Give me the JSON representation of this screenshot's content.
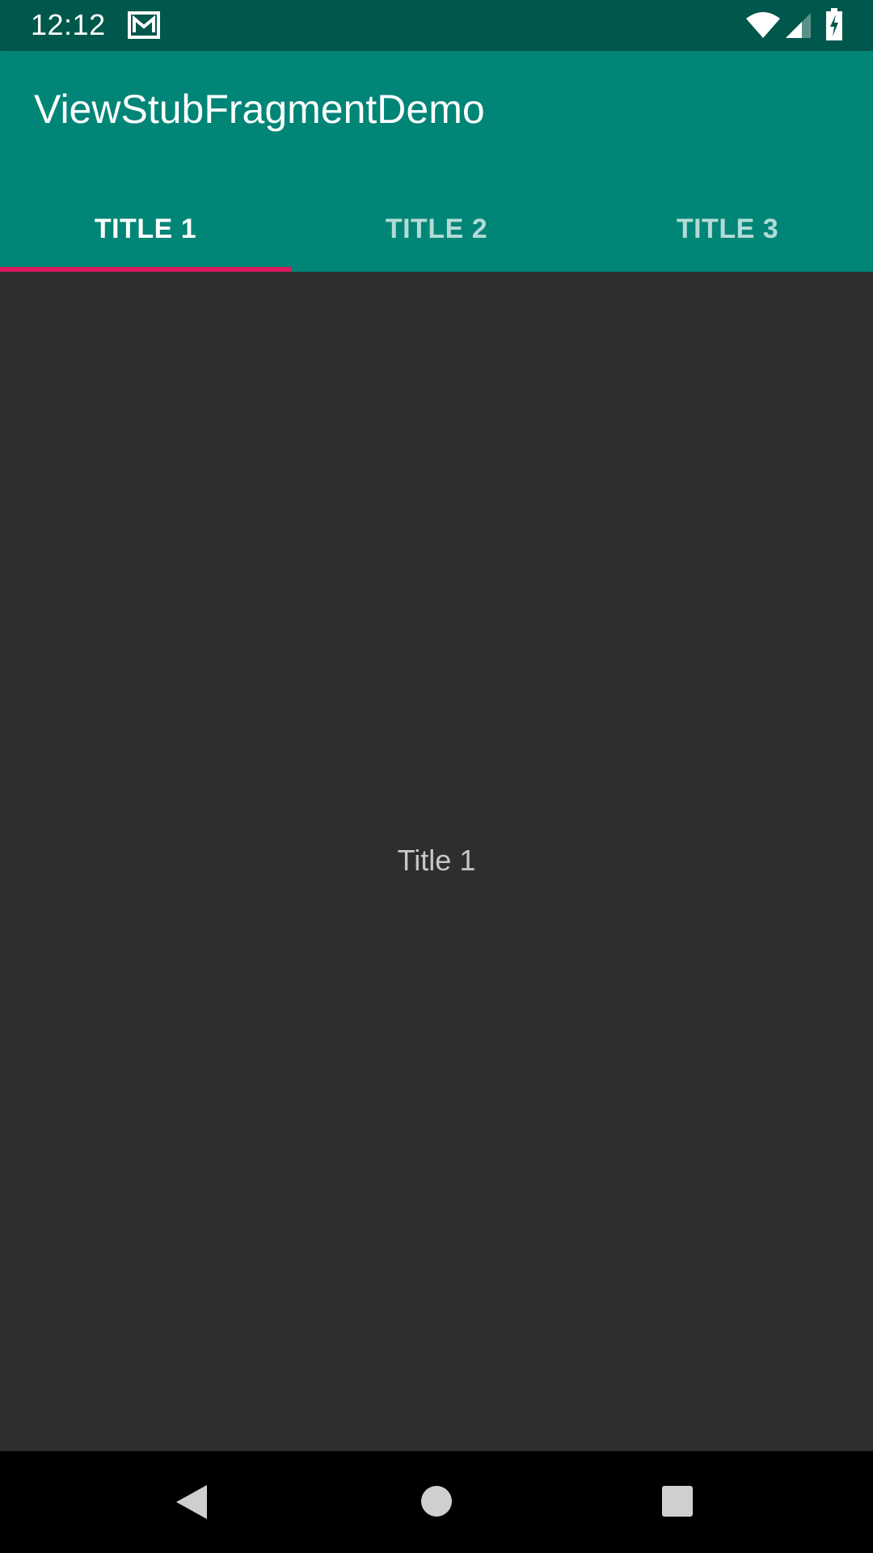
{
  "status_bar": {
    "time": "12:12",
    "icons": [
      "mail-icon",
      "wifi-icon",
      "signal-icon",
      "battery-charging-icon"
    ]
  },
  "app_bar": {
    "title": "ViewStubFragmentDemo",
    "color": "#008577",
    "status_color": "#00574b"
  },
  "tabs": [
    {
      "label": "TITLE 1",
      "active": true
    },
    {
      "label": "TITLE 2",
      "active": false
    },
    {
      "label": "TITLE 3",
      "active": false
    }
  ],
  "indicator_color": "#d81b60",
  "content": {
    "text": "Title 1"
  },
  "nav_bar": {
    "icons": [
      "back-icon",
      "home-icon",
      "recents-icon"
    ]
  }
}
